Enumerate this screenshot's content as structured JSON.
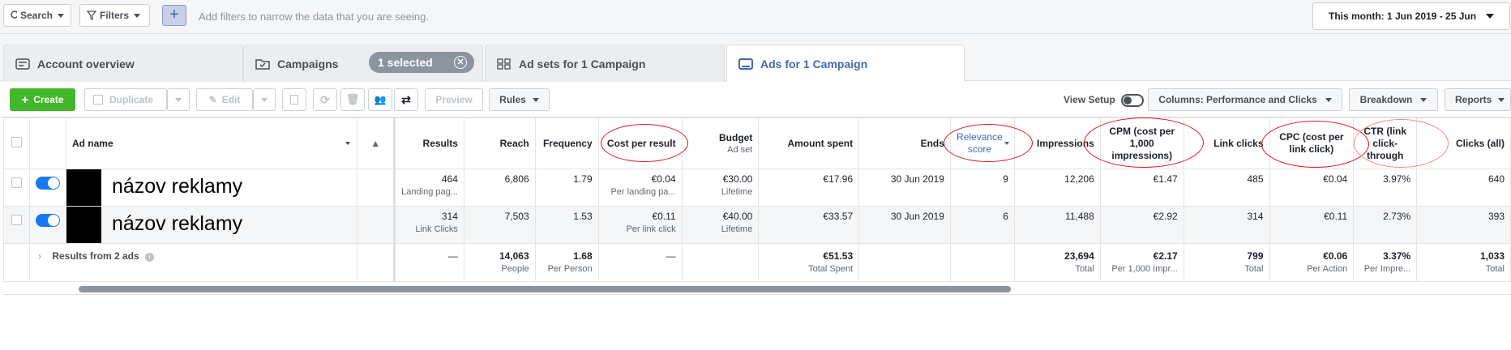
{
  "topbar": {
    "search_label": "Search",
    "filters_label": "Filters",
    "add_filter_symbol": "+",
    "filter_hint": "Add filters to narrow the data that you are seeing.",
    "date_range": "This month: 1 Jun 2019 - 25 Jun"
  },
  "tabs": [
    {
      "label": "Account overview",
      "icon": "account-overview-icon"
    },
    {
      "label": "Campaigns",
      "icon": "campaigns-folder-icon",
      "badge": "1 selected"
    },
    {
      "label": "Ad sets for 1 Campaign",
      "icon": "ad-sets-grid-icon"
    },
    {
      "label": "Ads for 1 Campaign",
      "icon": "ads-icon",
      "active": true
    }
  ],
  "toolbar": {
    "create": "Create",
    "duplicate": "Duplicate",
    "edit": "Edit",
    "preview": "Preview",
    "rules": "Rules",
    "view_setup": "View Setup",
    "columns": "Columns: Performance and Clicks",
    "breakdown": "Breakdown",
    "reports": "Reports"
  },
  "table": {
    "headers": {
      "ad_name": "Ad name",
      "results": "Results",
      "reach": "Reach",
      "frequency": "Frequency",
      "cost_per_result": "Cost per result",
      "budget": "Budget",
      "budget_sub": "Ad set",
      "amount_spent": "Amount spent",
      "ends": "Ends",
      "relevance": "Relevance score",
      "impressions": "Impressions",
      "cpm": "CPM (cost per 1,000 impressions)",
      "link_clicks": "Link clicks",
      "cpc": "CPC (cost per link click)",
      "ctr": "CTR (link click-through",
      "clicks_all": "Clicks (all)"
    },
    "rows": [
      {
        "name": "názov reklamy",
        "results": "464",
        "results_sub": "Landing pag...",
        "reach": "6,806",
        "frequency": "1.79",
        "cpr": "€0.04",
        "cpr_sub": "Per landing pa...",
        "budget": "€30.00",
        "budget_sub": "Lifetime",
        "spent": "€17.96",
        "ends": "30 Jun 2019",
        "relevance": "9",
        "impressions": "12,206",
        "cpm": "€1.47",
        "link_clicks": "485",
        "cpc": "€0.04",
        "ctr": "3.97%",
        "clicks_all": "640"
      },
      {
        "name": "názov reklamy",
        "results": "314",
        "results_sub": "Link Clicks",
        "reach": "7,503",
        "frequency": "1.53",
        "cpr": "€0.11",
        "cpr_sub": "Per link click",
        "budget": "€40.00",
        "budget_sub": "Lifetime",
        "spent": "€33.57",
        "ends": "30 Jun 2019",
        "relevance": "6",
        "impressions": "11,488",
        "cpm": "€2.92",
        "link_clicks": "314",
        "cpc": "€0.11",
        "ctr": "2.73%",
        "clicks_all": "393"
      }
    ],
    "totals": {
      "label": "Results from 2 ads",
      "results": "—",
      "reach": "14,063",
      "reach_sub": "People",
      "frequency": "1.68",
      "frequency_sub": "Per Person",
      "cpr": "—",
      "spent": "€51.53",
      "spent_sub": "Total Spent",
      "impressions": "23,694",
      "impressions_sub": "Total",
      "cpm": "€2.17",
      "cpm_sub": "Per 1,000 Impr...",
      "link_clicks": "799",
      "link_clicks_sub": "Total",
      "cpc": "€0.06",
      "cpc_sub": "Per Action",
      "ctr": "3.37%",
      "ctr_sub": "Per Impre...",
      "clicks_all": "1,033",
      "clicks_all_sub": "Total"
    }
  },
  "colors": {
    "accent": "#4267b2",
    "create_green": "#42b72a",
    "annotation_red": "#e0141e",
    "toggle_blue": "#1877f2"
  }
}
